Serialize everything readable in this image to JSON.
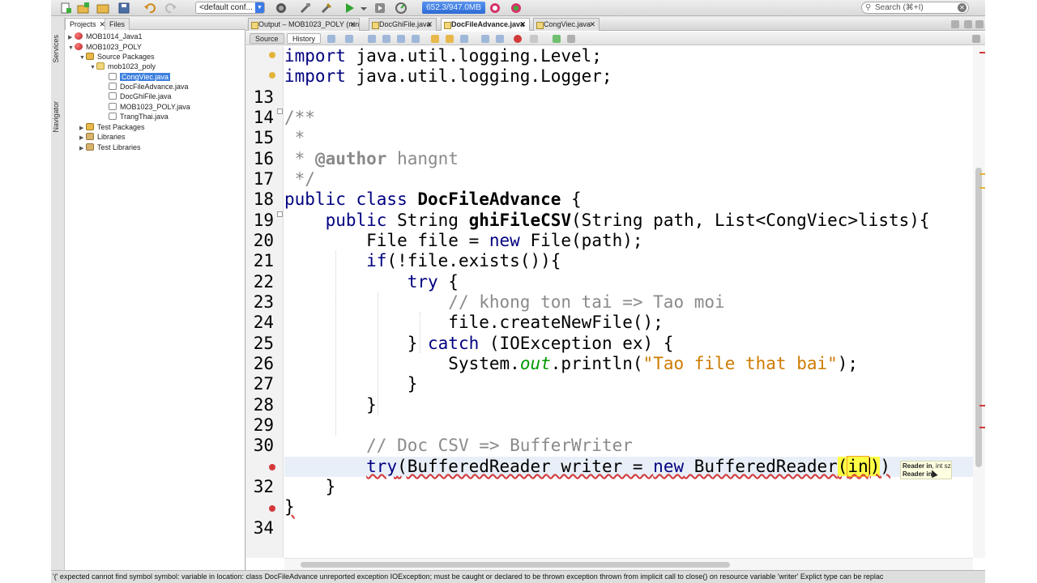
{
  "toolbar": {
    "config": "<default conf...",
    "memory": "652.3/947.0MB",
    "search_placeholder": "Search (⌘+I)",
    "icons": [
      "new-file-icon",
      "new-project-icon",
      "open-project-icon",
      "save-all-icon",
      "undo-icon",
      "redo-icon",
      "clean-build-icon",
      "build-icon",
      "run-icon",
      "debug-icon",
      "profile-icon",
      "gc-icon"
    ]
  },
  "side_tabs": {
    "services": "Services",
    "navigator": "Navigator"
  },
  "projects": {
    "tabs": [
      {
        "label": "Projects",
        "close": "✕"
      },
      {
        "label": "Files"
      }
    ],
    "tree": [
      {
        "label": "MOB1014_Java1"
      },
      {
        "label": "MOB1023_POLY"
      },
      {
        "label": "Source Packages"
      },
      {
        "label": "mob1023_poly"
      },
      {
        "label": "CongViec.java"
      },
      {
        "label": "DocFileAdvance.java"
      },
      {
        "label": "DocGhiFile.java"
      },
      {
        "label": "MOB1023_POLY.java"
      },
      {
        "label": "TrangThai.java"
      },
      {
        "label": "Test Packages"
      },
      {
        "label": "Libraries"
      },
      {
        "label": "Test Libraries"
      }
    ]
  },
  "editor": {
    "tabs": [
      {
        "label": "Output – MOB1023_POLY (run)",
        "close": "✕"
      },
      {
        "label": "DocGhiFile.java",
        "close": "✕"
      },
      {
        "label": "DocFileAdvance.java",
        "close": "✕"
      },
      {
        "label": "CongViec.java",
        "close": "✕"
      }
    ],
    "source_btn": "Source",
    "history_btn": "History",
    "line_numbers": [
      "",
      "",
      "13",
      "14",
      "15",
      "16",
      "17",
      "18",
      "19",
      "20",
      "21",
      "22",
      "23",
      "24",
      "25",
      "26",
      "27",
      "28",
      "29",
      "30",
      "",
      "32",
      "",
      "34"
    ],
    "code": {
      "l11_kw": "import",
      "l11_rest": " java.util.logging.Level;",
      "l12_kw": "import",
      "l12_rest": " java.util.logging.Logger;",
      "l14": "/**",
      "l15": " *",
      "l16_a": " * ",
      "l16_tag": "@author",
      "l16_b": " hangnt",
      "l17": " */",
      "l18_kw": "public class",
      "l18_cls": "DocFileAdvance",
      "l18_rest": " {",
      "l19_kw": "public",
      "l19_a": " String ",
      "l19_m": "ghiFileCSV",
      "l19_b": "(String path, List<CongViec>lists){",
      "l20_a": "File file = ",
      "l20_kw": "new",
      "l20_b": " File(path);",
      "l21_kw": "if",
      "l21_b": "(!file.exists()){",
      "l22_kw": "try",
      "l22_b": " {",
      "l23": "// khong ton tai => Tao moi",
      "l24": "file.createNewFile();",
      "l25_a": "} ",
      "l25_kw": "catch",
      "l25_b": " (IOException ex) {",
      "l26_a": "System.",
      "l26_fld": "out",
      "l26_b": ".println(",
      "l26_str": "\"Tao file that bai\"",
      "l26_c": ");",
      "l27": "}",
      "l28": "}",
      "l30": "// Doc CSV => BufferWriter",
      "l31_kw": "try",
      "l31_a": "(BufferedReader writer = ",
      "l31_kw2": "new",
      "l31_b": " BufferedReader",
      "l31_p1": "(",
      "l31_in": "in",
      "l31_p2": ")",
      "l31_c": ")",
      "l32": "}",
      "l33": "}"
    },
    "tooltip_line1_bold": "Reader in",
    "tooltip_line1_rest": ", int sz",
    "tooltip_line2": "Reader in"
  },
  "status": {
    "message": "'(' expected  cannot find symbol  symbol:   variable in   location: class DocFileAdvance  unreported exception IOException; must be caught or declared to be thrown   exception thrown from implicit call to close() on resource variable 'writer'  Explict type can be replac"
  },
  "colors": {
    "keyword": "#000080",
    "comment": "#8a8a8a",
    "string": "#ce7b00",
    "field": "#009900",
    "selection": "#3d80df",
    "current_line": "#e9eff8",
    "highlight": "#ffff46"
  }
}
